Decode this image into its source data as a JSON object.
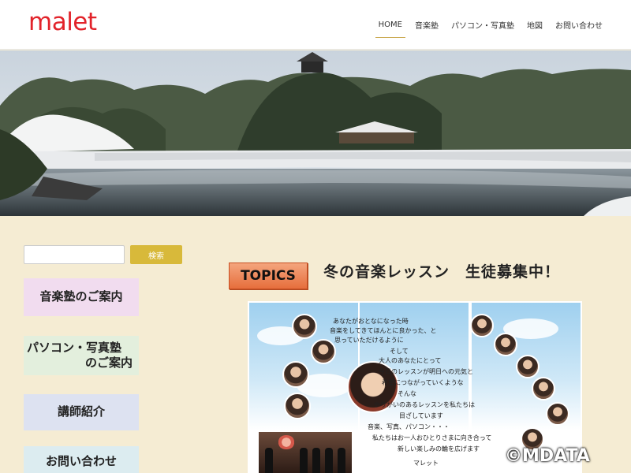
{
  "header": {
    "logo": "malet",
    "nav": [
      "HOME",
      "音楽塾",
      "パソコン・写真塾",
      "地図",
      "お問い合わせ"
    ]
  },
  "sidebar": {
    "search_button": "検索",
    "search_placeholder": "",
    "buttons": {
      "music": "音楽塾のご案内",
      "pc_line1": "パソコン・写真塾",
      "pc_line2": "のご案内",
      "instructors": "講師紹介",
      "contact": "お問い合わせ"
    }
  },
  "main": {
    "topics_label": "TOPICS",
    "headline": "冬の音楽レッスン　生徒募集中！",
    "poster_text": [
      "あなたがおとなになった時",
      "音楽をしてきてほんとに良かった、と",
      "思っていただけるように",
      "そして",
      "大人のあなたにとって",
      "今日のレッスンが明日への元気と",
      "希望につながっていくような",
      "そんな",
      "やりがいのあるレッスンを私たちは",
      "目ざしています",
      "音楽、写真、パソコン・・・",
      "私たちはお一人おひとりさまに向き合って",
      "新しい楽しみの輪を広げます",
      "マレット"
    ]
  },
  "watermark": "©MDATA",
  "colors": {
    "logo": "#e2232a",
    "search_button": "#d8b93a",
    "topics_badge": "#e66e3c",
    "page_background": "#f5ecd3"
  }
}
